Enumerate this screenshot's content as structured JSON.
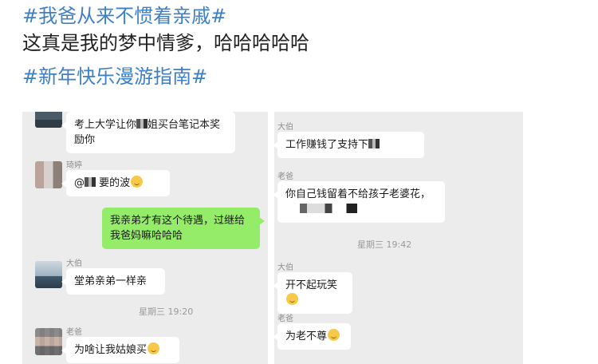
{
  "post": {
    "hashtag1": "#我爸从来不惯着亲戚#",
    "text": "这真是我的梦中情爹，哈哈哈哈哈",
    "hashtag2": "#新年快乐漫游指南#"
  },
  "left_chat": {
    "msg1": "考上大学让你",
    "msg1_tail": "姐买台笔记本奖励你",
    "sender2": "琦婷",
    "msg2_prefix": "@",
    "msg2_text": "要的波",
    "msg3": "我亲弟才有这个待遇，过继给我爸妈嘛哈哈哈",
    "sender4": "大伯",
    "msg4": "堂弟亲弟一样亲",
    "time": "星期三 19:20",
    "sender5": "老爸",
    "msg5": "为啥让我姑娘买"
  },
  "right_chat": {
    "sender1": "大伯",
    "msg1": "工作赚钱了支持下",
    "sender2": "老爸",
    "msg2": "你自己钱留着不给孩子老婆花，",
    "time": "星期三 19:42",
    "sender3": "大伯",
    "msg3": "开不起玩笑",
    "sender4": "老爸",
    "msg4": "为老不尊"
  },
  "icons": [
    "smile-emoji-icon",
    "blurred-name-icon"
  ],
  "colors": {
    "hashtag": "#3f7fc6",
    "green_bubble": "#95ec69",
    "chat_bg": "#ececec"
  }
}
